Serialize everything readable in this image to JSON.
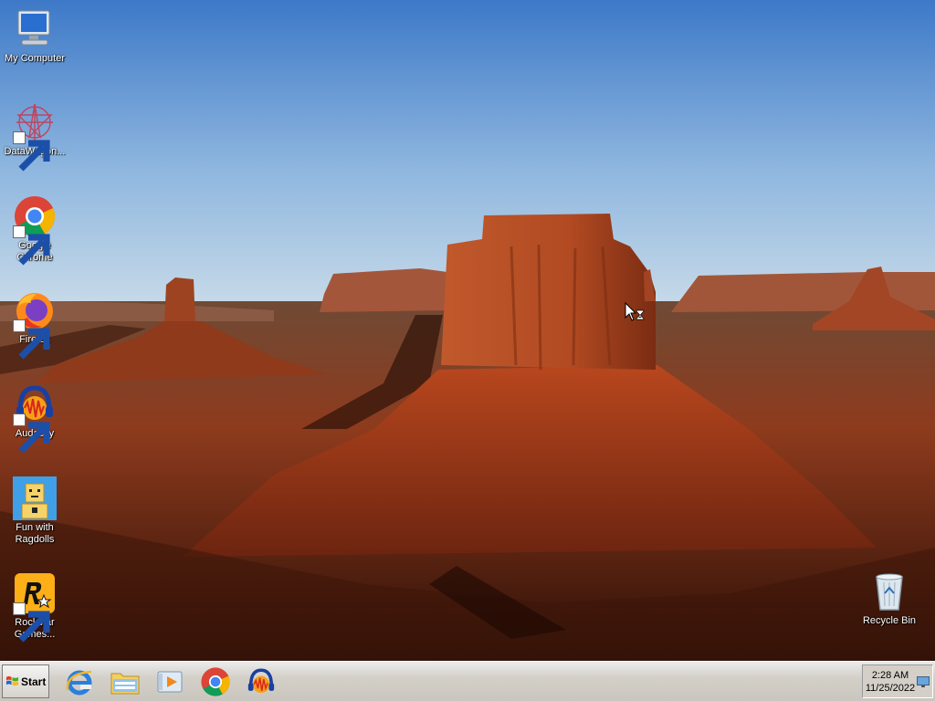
{
  "desktop": {
    "icons": [
      {
        "label": "My Computer",
        "icon": "computer-icon"
      },
      {
        "label": "DataWagon...",
        "icon": "datawagon-icon",
        "shortcut": true
      },
      {
        "label": "Google Chrome",
        "icon": "chrome-icon",
        "shortcut": true
      },
      {
        "label": "Firefox",
        "icon": "firefox-icon",
        "shortcut": true
      },
      {
        "label": "Audacity",
        "icon": "audacity-icon",
        "shortcut": true
      },
      {
        "label": "Fun with Ragdolls",
        "icon": "ragdolls-icon"
      },
      {
        "label": "Rockstar Games...",
        "icon": "rockstar-icon",
        "shortcut": true
      },
      {
        "label": "Recycle Bin",
        "icon": "recycle-bin-icon"
      }
    ]
  },
  "taskbar": {
    "start_label": "Start",
    "quick_launch": [
      "internet-explorer-icon",
      "windows-explorer-icon",
      "media-player-icon",
      "chrome-icon",
      "audacity-icon"
    ],
    "clock": {
      "time": "2:28 AM",
      "date": "11/25/2022"
    }
  },
  "colors": {
    "sky": "#4a86cf",
    "rock": "#b8512a",
    "taskbar": "#d4d0c8"
  }
}
